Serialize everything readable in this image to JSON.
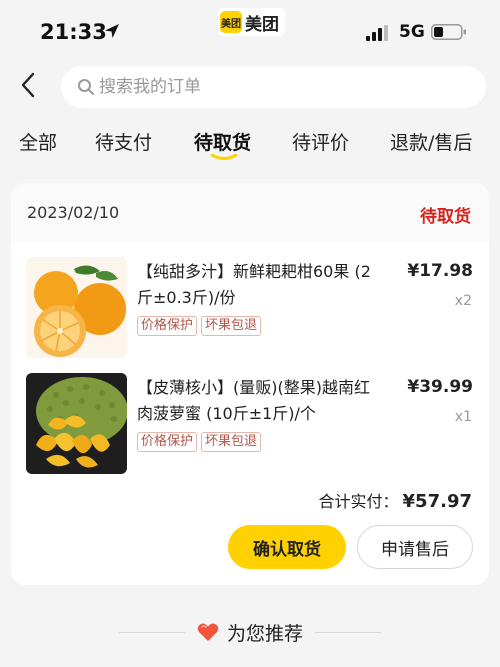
{
  "status_bar": {
    "time": "21:33",
    "app_logo_text": "美团",
    "app_name": "美团",
    "network": "5G",
    "location_icon": "location-arrow-icon",
    "signal_icon": "signal-icon",
    "battery_icon": "battery-icon"
  },
  "header": {
    "back_icon": "chevron-left-icon",
    "search_placeholder": "搜索我的订单",
    "search_value": ""
  },
  "tabs": [
    {
      "label": "全部",
      "active": false
    },
    {
      "label": "待支付",
      "active": false
    },
    {
      "label": "待取货",
      "active": true
    },
    {
      "label": "待评价",
      "active": false
    },
    {
      "label": "退款/售后",
      "active": false
    }
  ],
  "order": {
    "date": "2023/02/10",
    "status": "待取货",
    "products": [
      {
        "title": "【纯甜多汁】新鲜耙耙柑60果 (2斤±0.3斤)/份",
        "price": "¥17.98",
        "qty": "x2",
        "tags": [
          "价格保护",
          "坏果包退"
        ],
        "image": "mandarin-orange-image"
      },
      {
        "title": "【皮薄核小】(量贩)(整果)越南红肉菠萝蜜 (10斤±1斤)/个",
        "price": "¥39.99",
        "qty": "x1",
        "tags": [
          "价格保护",
          "坏果包退"
        ],
        "image": "jackfruit-image"
      }
    ],
    "total_label": "合计实付：",
    "total_value": "¥57.97",
    "confirm_button": "确认取货",
    "aftersale_button": "申请售后"
  },
  "recommend": {
    "label": "为您推荐",
    "icon": "heart-icon"
  },
  "colors": {
    "accent_yellow": "#ffd100",
    "status_red": "#d9241b",
    "tag_color": "#b0574b"
  }
}
